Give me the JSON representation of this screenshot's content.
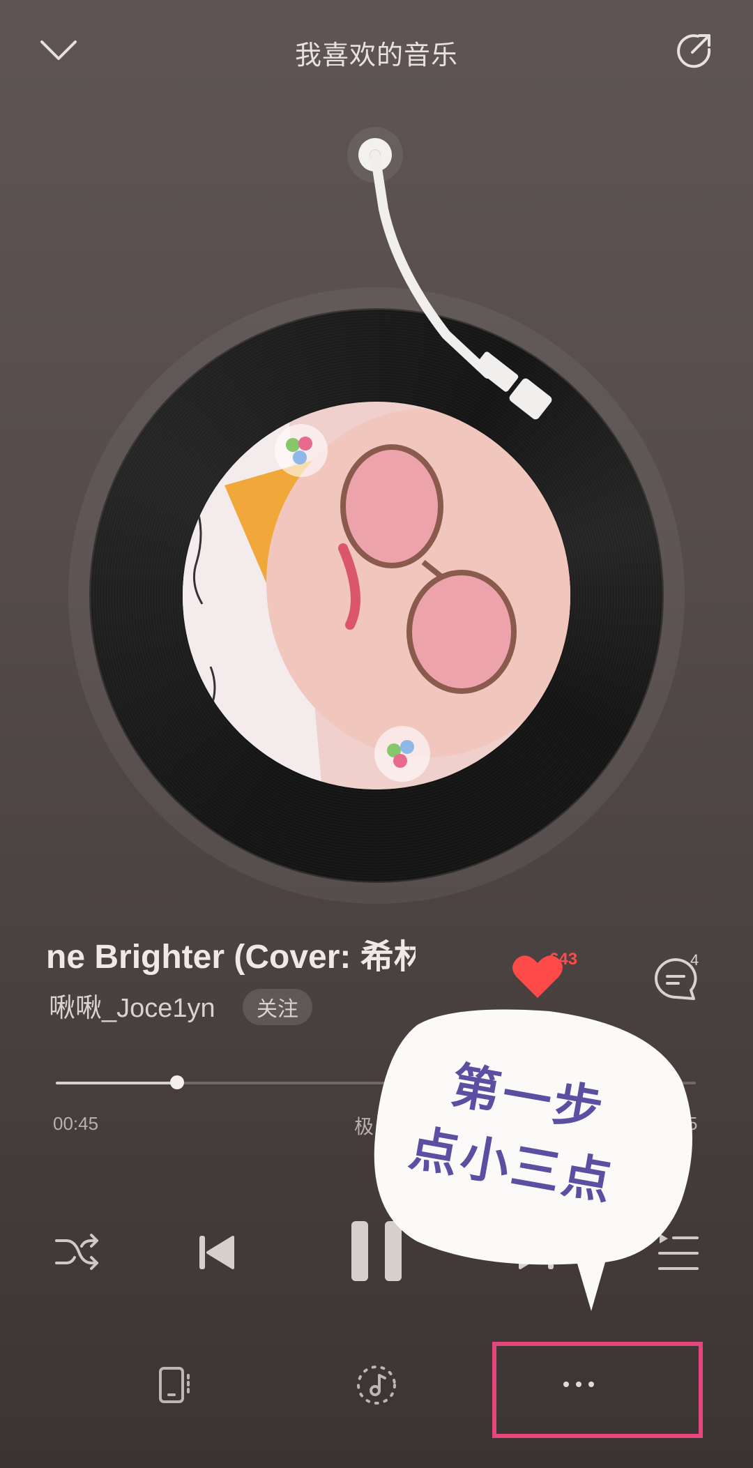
{
  "header": {
    "title": "我喜欢的音乐"
  },
  "song": {
    "title": "ne Brighter (Cover: 希林",
    "artist": "啾啾_Joce1yn",
    "follow_label": "关注",
    "like_count": "643",
    "comment_count": "4"
  },
  "progress": {
    "elapsed": "00:45",
    "total_visible": "5",
    "fraction": 0.19,
    "quality_label": "极"
  },
  "annotation": {
    "line1": "第一步",
    "line2": "点小三点",
    "highlight_color": "#e5467d",
    "text_color": "#5a4fa1"
  },
  "icons": {
    "collapse": "chevron-down-icon",
    "share": "share-icon",
    "like": "heart-icon",
    "comment": "comment-icon",
    "shuffle": "shuffle-icon",
    "previous": "previous-icon",
    "pause": "pause-icon",
    "next": "next-icon",
    "playlist": "playlist-icon",
    "device": "device-icon",
    "effects": "sound-effect-icon",
    "more": "more-icon"
  },
  "colors": {
    "accent_like": "#ff4a4a",
    "background": "#554c4b"
  }
}
